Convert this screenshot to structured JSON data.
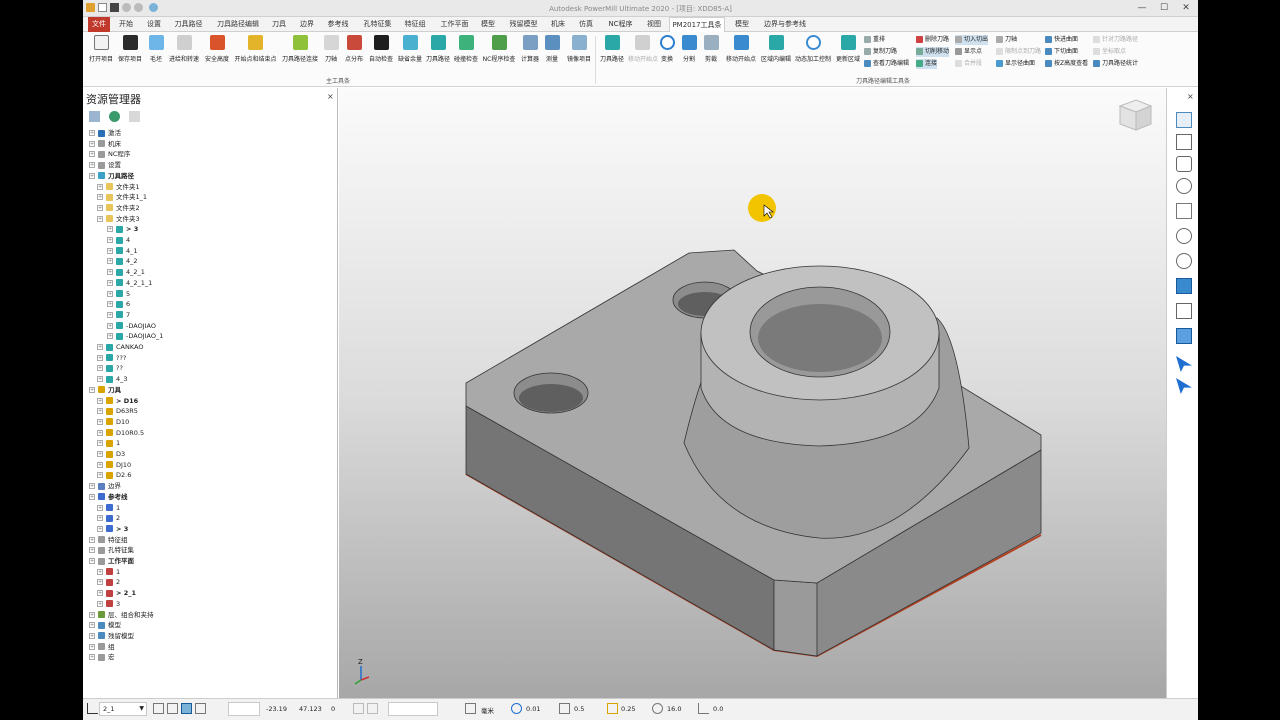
{
  "window": {
    "title": "Autodesk PowerMill Ultimate 2020 - [项目: XDD85-A]",
    "controls": [
      "—",
      "☐",
      "✕"
    ]
  },
  "tabs": [
    {
      "label": "文件"
    },
    {
      "label": "开始"
    },
    {
      "label": "设置"
    },
    {
      "label": "刀具路径"
    },
    {
      "label": "刀具路径编辑"
    },
    {
      "label": "刀具"
    },
    {
      "label": "边界"
    },
    {
      "label": "参考线"
    },
    {
      "label": "孔特征集"
    },
    {
      "label": "特征组"
    },
    {
      "label": "工作平面"
    },
    {
      "label": "模型"
    },
    {
      "label": "残留模型"
    },
    {
      "label": "机床"
    },
    {
      "label": "仿真"
    },
    {
      "label": "NC程序"
    },
    {
      "label": "视图"
    },
    {
      "label": "PM2017工具条"
    },
    {
      "label": "模型"
    },
    {
      "label": "边界与参考线"
    }
  ],
  "ribbon": {
    "buttons": [
      {
        "label": "打开项目"
      },
      {
        "label": "保存项目"
      },
      {
        "label": "毛坯"
      },
      {
        "label": "进给和转速"
      },
      {
        "label": "安全高度"
      },
      {
        "label": "开始点和结束点"
      },
      {
        "label": "刀具路径连接"
      },
      {
        "label": "刀轴"
      },
      {
        "label": "点分布"
      },
      {
        "label": "自动检查"
      },
      {
        "label": "缺省余量"
      },
      {
        "label": "刀具路径"
      },
      {
        "label": "碰撞检查"
      },
      {
        "label": "NC程序检查"
      },
      {
        "label": "计算器"
      },
      {
        "label": "测量"
      },
      {
        "label": "镜像项目"
      }
    ],
    "group_main": "主工具条",
    "edit_buttons": [
      {
        "label": "刀具路径"
      },
      {
        "label": "移动开始点"
      },
      {
        "label": "变换"
      },
      {
        "label": "分割"
      },
      {
        "label": "剪裁"
      },
      {
        "label": "移动开始点"
      },
      {
        "label": "区域内编辑"
      },
      {
        "label": "动态加工控制"
      },
      {
        "label": "更新区域"
      }
    ],
    "small_col1": [
      "重排",
      "复制刀路",
      "查看刀路编辑"
    ],
    "small_col2": [
      "删除刀路",
      "切削移动",
      "连接"
    ],
    "small_col3": [
      "切入切出",
      "显示点",
      "合并段"
    ],
    "small_col4": [
      "刀轴",
      "限制点到刀路",
      "显示径曲面"
    ],
    "small_col5": [
      "快进曲面",
      "下切曲面",
      "按Z高度查看"
    ],
    "small_col6": [
      "针对刀路路径",
      "坐标取点",
      "刀具路径统计"
    ],
    "group_edit": "刀具路径编辑工具条"
  },
  "explorer": {
    "title": "资源管理器",
    "close": "×",
    "tree": [
      {
        "label": "激活",
        "level": 0,
        "color": "#2b6fb5"
      },
      {
        "label": "机床",
        "level": 0,
        "color": "#9a9a9a"
      },
      {
        "label": "NC程序",
        "level": 0,
        "color": "#9a9a9a"
      },
      {
        "label": "设置",
        "level": 0,
        "color": "#9a9a9a"
      },
      {
        "label": "刀具路径",
        "level": 0,
        "color": "#3ca0c8",
        "bold": true
      },
      {
        "label": "文件夹1",
        "level": 1,
        "color": "#e8c45a"
      },
      {
        "label": "文件夹1_1",
        "level": 1,
        "color": "#e8c45a"
      },
      {
        "label": "文件夹2",
        "level": 1,
        "color": "#e8c45a"
      },
      {
        "label": "文件夹3",
        "level": 1,
        "color": "#e8c45a"
      },
      {
        "label": "> 3",
        "level": 2,
        "color": "#2aa7a7",
        "bold": true
      },
      {
        "label": "4",
        "level": 2,
        "color": "#2aa7a7"
      },
      {
        "label": "4_1",
        "level": 2,
        "color": "#2aa7a7"
      },
      {
        "label": "4_2",
        "level": 2,
        "color": "#2aa7a7"
      },
      {
        "label": "4_2_1",
        "level": 2,
        "color": "#2aa7a7"
      },
      {
        "label": "4_2_1_1",
        "level": 2,
        "color": "#2aa7a7"
      },
      {
        "label": "5",
        "level": 2,
        "color": "#2aa7a7"
      },
      {
        "label": "6",
        "level": 2,
        "color": "#2aa7a7"
      },
      {
        "label": "7",
        "level": 2,
        "color": "#2aa7a7"
      },
      {
        "label": "-DAOJIAO",
        "level": 2,
        "color": "#2aa7a7"
      },
      {
        "label": "-DAOJIAO_1",
        "level": 2,
        "color": "#2aa7a7"
      },
      {
        "label": "CANKAO",
        "level": 1,
        "color": "#2aa7a7"
      },
      {
        "label": "???",
        "level": 1,
        "color": "#2aa7a7"
      },
      {
        "label": "??",
        "level": 1,
        "color": "#2aa7a7"
      },
      {
        "label": "4_3",
        "level": 1,
        "color": "#2aa7a7"
      },
      {
        "label": "刀具",
        "level": 0,
        "color": "#d9a300",
        "bold": true
      },
      {
        "label": "> D16",
        "level": 1,
        "color": "#d9a300",
        "bold": true
      },
      {
        "label": "D63R5",
        "level": 1,
        "color": "#d9a300"
      },
      {
        "label": "D10",
        "level": 1,
        "color": "#d9a300"
      },
      {
        "label": "D10R0.5",
        "level": 1,
        "color": "#d9a300"
      },
      {
        "label": "1",
        "level": 1,
        "color": "#d9a300"
      },
      {
        "label": "D3",
        "level": 1,
        "color": "#d9a300"
      },
      {
        "label": "DJ10",
        "level": 1,
        "color": "#d9a300"
      },
      {
        "label": "D2.6",
        "level": 1,
        "color": "#d9a300"
      },
      {
        "label": "边界",
        "level": 0,
        "color": "#5a7fc0"
      },
      {
        "label": "参考线",
        "level": 0,
        "color": "#3d6bd0",
        "bold": true
      },
      {
        "label": "1",
        "level": 1,
        "color": "#3d6bd0"
      },
      {
        "label": "2",
        "level": 1,
        "color": "#3d6bd0"
      },
      {
        "label": "> 3",
        "level": 1,
        "color": "#3d6bd0",
        "bold": true
      },
      {
        "label": "特征组",
        "level": 0,
        "color": "#9a9a9a"
      },
      {
        "label": "孔特征集",
        "level": 0,
        "color": "#9a9a9a"
      },
      {
        "label": "工作平面",
        "level": 0,
        "color": "#9a9a9a",
        "bold": true
      },
      {
        "label": "1",
        "level": 1,
        "color": "#c04040"
      },
      {
        "label": "2",
        "level": 1,
        "color": "#c04040"
      },
      {
        "label": "> 2_1",
        "level": 1,
        "color": "#c04040",
        "bold": true
      },
      {
        "label": "3",
        "level": 1,
        "color": "#c04040"
      },
      {
        "label": "层、组合和夹持",
        "level": 0,
        "color": "#6a9a3a"
      },
      {
        "label": "模型",
        "level": 0,
        "color": "#4a8abf"
      },
      {
        "label": "残留模型",
        "level": 0,
        "color": "#4a8abf"
      },
      {
        "label": "组",
        "level": 0,
        "color": "#9a9a9a"
      },
      {
        "label": "宏",
        "level": 0,
        "color": "#9a9a9a"
      }
    ]
  },
  "viewport": {
    "axis_label": "Z"
  },
  "statusbar": {
    "workplane": "2_1",
    "x": "-23.19",
    "y": "47.123",
    "z": "0",
    "units": "毫米",
    "tolerance": "0.01",
    "thickness": "0.5",
    "tool_diam": "0.25",
    "diameter": "16.0",
    "angle": "0.0"
  },
  "colors": {
    "accent": "#c0392b",
    "part": "#9c9c9c",
    "toolpath_blue": "#2b6fb5"
  }
}
